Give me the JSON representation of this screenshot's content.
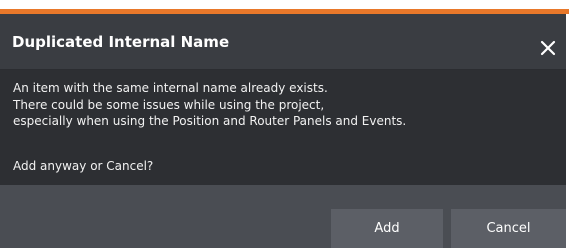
{
  "dialog": {
    "title": "Duplicated Internal Name",
    "close_icon": "close-icon",
    "message_lines": [
      "An item with the same internal name already exists.",
      "There could be some issues while using the project,",
      "especially when using the Position and Router Panels and Events."
    ],
    "question": "Add anyway or Cancel?",
    "buttons": {
      "add_label": "Add",
      "cancel_label": "Cancel"
    }
  },
  "colors": {
    "accent": "#e8782a",
    "header_bg": "#3a3d42",
    "body_bg": "#2d2f33",
    "footer_bg": "#4a4d53",
    "button_bg": "#5c5f66",
    "text": "#ffffff"
  }
}
